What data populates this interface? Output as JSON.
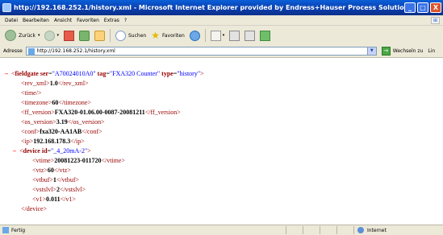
{
  "window": {
    "title": "http://192.168.252.1/history.xml - Microsoft Internet Explorer provided by Endress+Hauser Process Solutions",
    "controls": [
      "_",
      "□",
      "X"
    ]
  },
  "menu": [
    "Datei",
    "Bearbeiten",
    "Ansicht",
    "Favoriten",
    "Extras",
    "?"
  ],
  "toolbar": {
    "back_label": "Zurück",
    "search_label": "Suchen",
    "favorites_label": "Favoriten"
  },
  "address": {
    "label": "Adresse",
    "url": "http://192.168.252.1/history.xml",
    "go_label": "Wechseln zu",
    "links_label": "Lin"
  },
  "xml": {
    "minus": "–",
    "root_open": {
      "tag": "fieldgate",
      "attrs": [
        {
          "name": "ser",
          "value": "\"A70024010A0\""
        },
        {
          "name": "tag",
          "value": "\"FXA320 Counter\""
        },
        {
          "name": "type",
          "value": "\"history\""
        }
      ]
    },
    "rev_xml": {
      "tag": "rev_xml",
      "value": "1.0"
    },
    "time": {
      "tag": "time"
    },
    "timezone": {
      "tag": "timezone",
      "value": "60"
    },
    "ff_version": {
      "tag": "ff_version",
      "value": "FXA320-01.06.00-0087-20081211"
    },
    "os_version": {
      "tag": "os_version",
      "value": "3.19"
    },
    "conf": {
      "tag": "conf",
      "value": "fxa320-AA1AB"
    },
    "ip": {
      "tag": "ip",
      "value": "192.168.178.3"
    },
    "device_open": {
      "tag": "device",
      "attr_name": "id",
      "attr_value": "\"_4_20mA-2\""
    },
    "vtime": {
      "tag": "vtime",
      "value": "20081223-011720"
    },
    "vtz": {
      "tag": "vtz",
      "value": "60"
    },
    "vtbuf": {
      "tag": "vtbuf",
      "value": "1"
    },
    "vstslvl": {
      "tag": "vstslvl",
      "value": "2"
    },
    "v1": {
      "tag": "v1",
      "value": "0.011"
    },
    "device_close": {
      "tag": "device"
    }
  },
  "status": {
    "text": "Fertig",
    "zone": "Internet"
  }
}
